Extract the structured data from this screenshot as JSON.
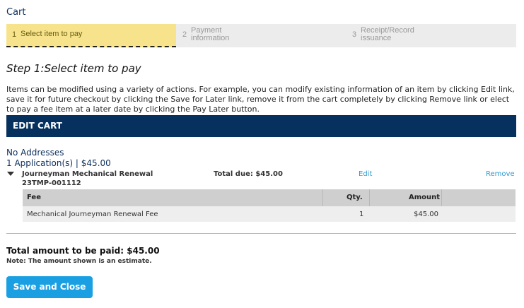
{
  "cart_title": "Cart",
  "steps": [
    {
      "num": "1",
      "label": "Select item to pay",
      "active": true
    },
    {
      "num": "2",
      "label_line1": "Payment",
      "label_line2": "information"
    },
    {
      "num": "3",
      "label_line1": "Receipt/Record",
      "label_line2": "issuance"
    }
  ],
  "step_heading": "Step 1:Select item to pay",
  "intro_text": "Items can be modified using a variety of actions. For example, you can modify existing information of an item by clicking Edit link, save it for future checkout by clicking the Save for Later link, remove it from the cart completely by clicking Remove link or elect to pay a fee item at a later date by clicking the Pay Later button.",
  "edit_cart": "EDIT CART",
  "address_label": "No Addresses",
  "app_count": "1 Application(s) | $45.00",
  "record": {
    "name": "Journeyman Mechanical Renewal",
    "number": "23TMP-001112",
    "total_due": "Total due: $45.00",
    "edit_label": "Edit",
    "remove_label": "Remove"
  },
  "fee_table": {
    "headers": {
      "fee": "Fee",
      "qty": "Qty.",
      "amount": "Amount"
    },
    "rows": [
      {
        "fee": "Mechanical Journeyman Renewal Fee",
        "qty": "1",
        "amount": "$45.00"
      }
    ]
  },
  "total_amount": "Total amount to be paid: $45.00",
  "note": "Note: The amount shown is an estimate.",
  "save_button": "Save and Close",
  "colors": {
    "header_bar": "#06305e",
    "active_step": "#f6e38c",
    "link": "#2e9ad1",
    "button": "#1aa0e2"
  }
}
